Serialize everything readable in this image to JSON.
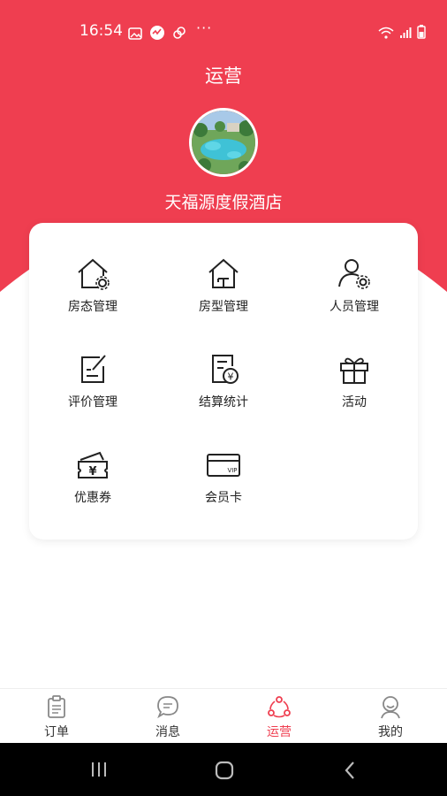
{
  "status_bar": {
    "time": "16:54",
    "dots": "···"
  },
  "page": {
    "title": "运营"
  },
  "hotel": {
    "name": "天福源度假酒店"
  },
  "menu": [
    {
      "label": "房态管理",
      "icon": "house-gear-icon"
    },
    {
      "label": "房型管理",
      "icon": "house-layout-icon"
    },
    {
      "label": "人员管理",
      "icon": "person-gear-icon"
    },
    {
      "label": "评价管理",
      "icon": "edit-note-icon"
    },
    {
      "label": "结算统计",
      "icon": "yuan-document-icon"
    },
    {
      "label": "活动",
      "icon": "gift-icon"
    },
    {
      "label": "优惠券",
      "icon": "coupon-wallet-icon"
    },
    {
      "label": "会员卡",
      "icon": "vip-card-icon"
    }
  ],
  "bottom_nav": [
    {
      "label": "订单",
      "icon": "clipboard-icon",
      "active": false
    },
    {
      "label": "消息",
      "icon": "chat-bubble-icon",
      "active": false
    },
    {
      "label": "运营",
      "icon": "share-nodes-icon",
      "active": true
    },
    {
      "label": "我的",
      "icon": "user-icon",
      "active": false
    }
  ],
  "colors": {
    "brand_red": "#ef3e50",
    "card_bg": "#ffffff",
    "nav_active": "#ef3e50"
  }
}
